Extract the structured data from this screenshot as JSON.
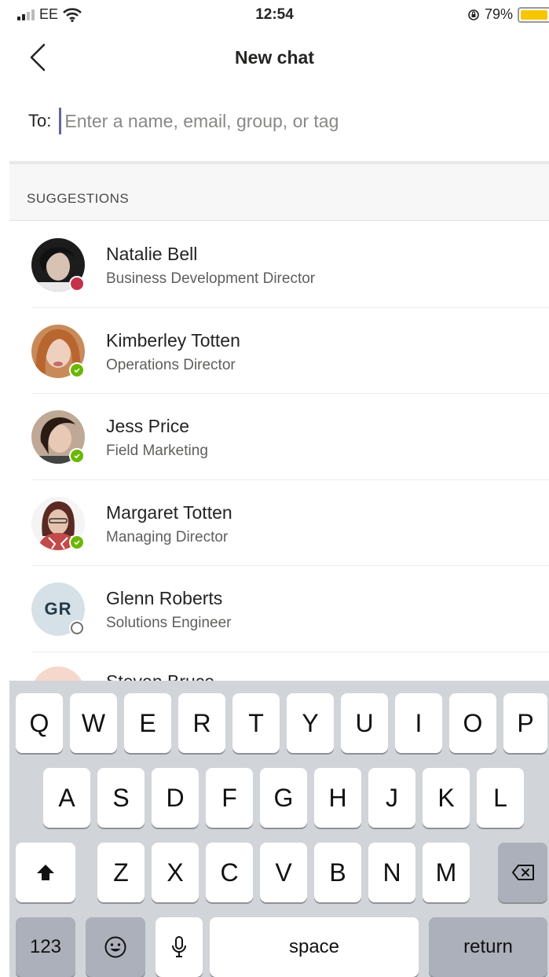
{
  "status_bar": {
    "carrier": "EE",
    "time": "12:54",
    "battery": "79%"
  },
  "header": {
    "title": "New chat"
  },
  "to_field": {
    "label": "To:",
    "placeholder": "Enter a name, email, group, or tag"
  },
  "suggestions": {
    "label": "SUGGESTIONS",
    "people": [
      {
        "name": "Natalie Bell",
        "role": "Business Development Director",
        "presence": "busy"
      },
      {
        "name": "Kimberley Totten",
        "role": "Operations Director",
        "presence": "available"
      },
      {
        "name": "Jess Price",
        "role": "Field Marketing",
        "presence": "available"
      },
      {
        "name": "Margaret Totten",
        "role": "Managing Director",
        "presence": "available"
      },
      {
        "name": "Glenn Roberts",
        "role": "Solutions Engineer",
        "presence": "offline",
        "initials": "GR"
      }
    ],
    "partial_name": "Steven Bruce"
  },
  "keyboard": {
    "row1": [
      "Q",
      "W",
      "E",
      "R",
      "T",
      "Y",
      "U",
      "I",
      "O",
      "P"
    ],
    "row2": [
      "A",
      "S",
      "D",
      "F",
      "G",
      "H",
      "J",
      "K",
      "L"
    ],
    "row3": [
      "Z",
      "X",
      "C",
      "V",
      "B",
      "N",
      "M"
    ],
    "numbers": "123",
    "space": "space",
    "return": "return"
  },
  "icons": {
    "back": "chevron-left-icon",
    "shift": "shift-arrow-icon",
    "backspace": "backspace-icon",
    "emoji": "emoji-icon",
    "mic": "microphone-icon",
    "wifi": "wifi-icon",
    "orientation_lock": "orientation-lock-icon"
  },
  "colors": {
    "accent": "#6264a7",
    "busy": "#c4314b",
    "available": "#6bb700",
    "battery": "#f7c600",
    "keyboard_bg": "#d1d4d9"
  }
}
